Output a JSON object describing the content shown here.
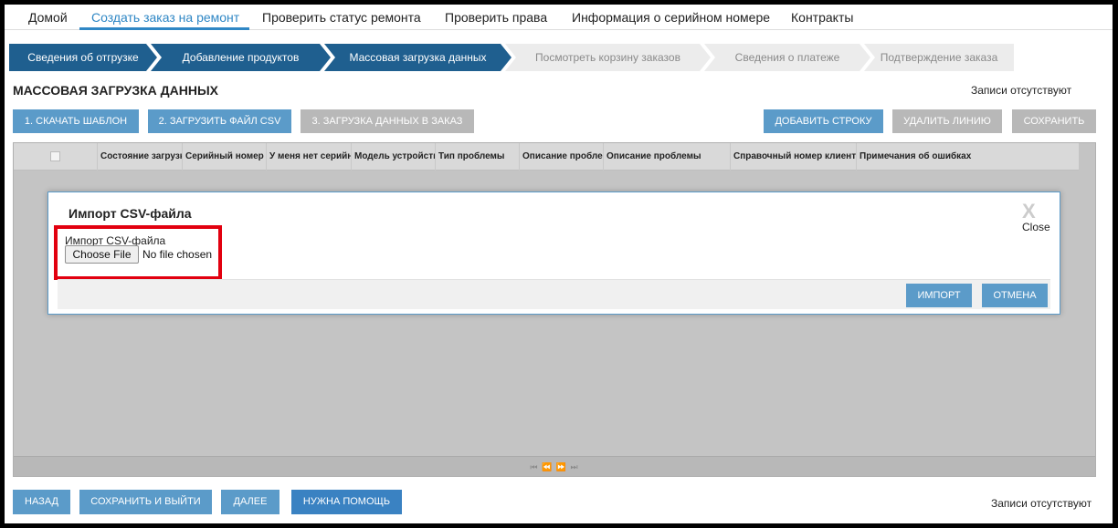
{
  "nav": {
    "items": [
      {
        "label": "Домой"
      },
      {
        "label": "Создать заказ на ремонт"
      },
      {
        "label": "Проверить статус ремонта"
      },
      {
        "label": "Проверить права"
      },
      {
        "label": "Информация о серийном номере"
      },
      {
        "label": "Контракты"
      }
    ]
  },
  "steps": [
    {
      "label": "Сведения об отгрузке",
      "state": "completed"
    },
    {
      "label": "Добавление продуктов",
      "state": "completed"
    },
    {
      "label": "Массовая загрузка данных",
      "state": "current"
    },
    {
      "label": "Посмотреть корзину заказов",
      "state": "pending"
    },
    {
      "label": "Сведения о платеже",
      "state": "pending"
    },
    {
      "label": "Подтверждение заказа",
      "state": "pending"
    }
  ],
  "page": {
    "title": "МАССОВАЯ ЗАГРУЗКА ДАННЫХ",
    "records_status": "Записи отсутствуют"
  },
  "actions": {
    "download_template": "1. СКАЧАТЬ ШАБЛОН",
    "upload_csv": "2. ЗАГРУЗИТЬ ФАЙЛ CSV",
    "load_to_order": "3. ЗАГРУЗКА ДАННЫХ В ЗАКАЗ",
    "add_row": "ДОБАВИТЬ СТРОКУ",
    "delete_line": "УДАЛИТЬ ЛИНИЮ",
    "save": "СОХРАНИТЬ"
  },
  "grid": {
    "columns": [
      "Состояние загрузки",
      "Серийный номер",
      "У меня нет серийного номера",
      "Модель устройства",
      "Тип проблемы",
      "Описание проблемы",
      "Описание проблемы",
      "Справочный номер клиента",
      "Примечания об ошибках"
    ],
    "pager_icons": "first-icon prev-icon next-icon last-icon"
  },
  "dialog": {
    "title": "Импорт CSV-файла",
    "close_icon": "X",
    "close_label": "Close",
    "file_label": "Импорт CSV-файла",
    "choose_file": "Choose File",
    "file_status": "No file chosen",
    "import": "ИМПОРТ",
    "cancel": "ОТМЕНА",
    "highlight_color": "#e2000f"
  },
  "footer": {
    "back": "НАЗАД",
    "save_exit": "СОХРАНИТЬ И ВЫЙТИ",
    "next": "ДАЛЕЕ",
    "help": "НУЖНА ПОМОЩЬ",
    "records_status": "Записи отсутствуют"
  },
  "colors": {
    "accent": "#2f87c5",
    "step_active": "#1f5f8f",
    "step_pending": "#ececec",
    "button_disabled": "#b8b8b8"
  }
}
